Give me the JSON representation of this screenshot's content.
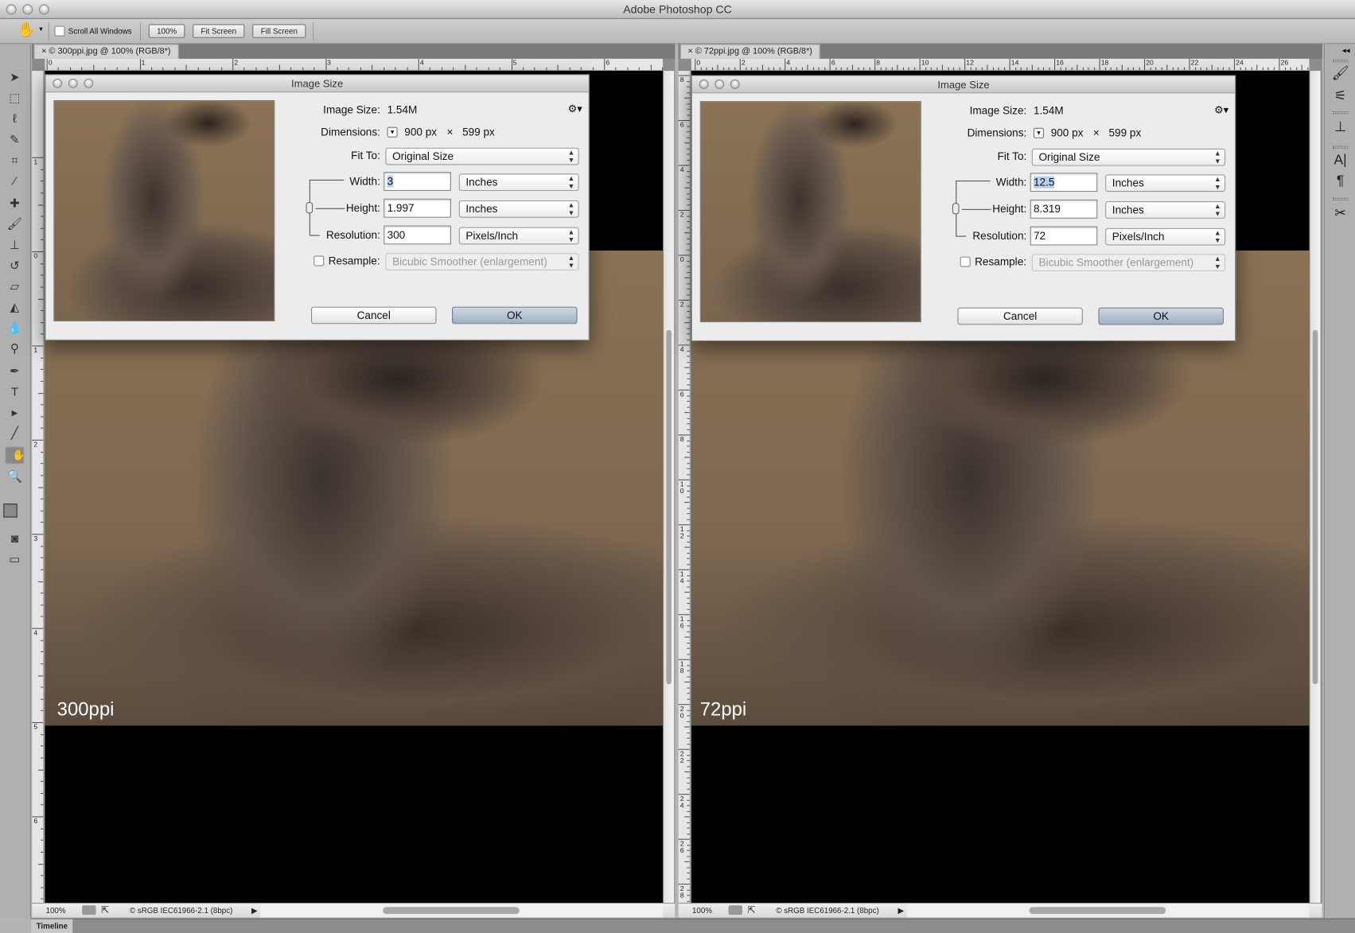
{
  "app": {
    "title": "Adobe Photoshop CC"
  },
  "options": {
    "scroll_all_windows": "Scroll All Windows",
    "zoom100": "100%",
    "fit_screen": "Fit Screen",
    "fill_screen": "Fill Screen"
  },
  "docs": [
    {
      "tab": "×  © 300ppi.jpg @ 100% (RGB/8*)",
      "overlay": "300ppi",
      "zoom": "100%",
      "profile": "© sRGB IEC61966-2.1 (8bpc)",
      "hruler": [
        "0",
        "1",
        "2",
        "3",
        "4",
        "5",
        "6"
      ],
      "vruler": [
        "1",
        "0",
        "1",
        "2",
        "3",
        "4",
        "5",
        "6"
      ]
    },
    {
      "tab": "×  © 72ppi.jpg @ 100% (RGB/8*)",
      "overlay": "72ppi",
      "zoom": "100%",
      "profile": "© sRGB IEC61966-2.1 (8bpc)",
      "hruler": [
        "0",
        "2",
        "4",
        "6",
        "8",
        "10",
        "12",
        "14",
        "16",
        "18",
        "20",
        "22",
        "24",
        "26"
      ],
      "vruler": [
        "8",
        "6",
        "4",
        "2",
        "0",
        "2",
        "4",
        "6",
        "8",
        "10",
        "12",
        "14",
        "16",
        "18",
        "20",
        "22",
        "24",
        "26",
        "28"
      ]
    }
  ],
  "dialogs": [
    {
      "title": "Image Size",
      "image_size_label": "Image Size:",
      "image_size": "1.54M",
      "dimensions_label": "Dimensions:",
      "dim_w": "900 px",
      "times": "×",
      "dim_h": "599 px",
      "fit_to_label": "Fit To:",
      "fit_to": "Original Size",
      "width_label": "Width:",
      "width": "3",
      "width_unit": "Inches",
      "height_label": "Height:",
      "height": "1.997",
      "height_unit": "Inches",
      "resolution_label": "Resolution:",
      "resolution": "300",
      "resolution_unit": "Pixels/Inch",
      "resample_label": "Resample:",
      "resample": "Bicubic Smoother (enlargement)",
      "cancel": "Cancel",
      "ok": "OK"
    },
    {
      "title": "Image Size",
      "image_size_label": "Image Size:",
      "image_size": "1.54M",
      "dimensions_label": "Dimensions:",
      "dim_w": "900 px",
      "times": "×",
      "dim_h": "599 px",
      "fit_to_label": "Fit To:",
      "fit_to": "Original Size",
      "width_label": "Width:",
      "width": "12.5",
      "width_unit": "Inches",
      "height_label": "Height:",
      "height": "8.319",
      "height_unit": "Inches",
      "resolution_label": "Resolution:",
      "resolution": "72",
      "resolution_unit": "Pixels/Inch",
      "resample_label": "Resample:",
      "resample": "Bicubic Smoother (enlargement)",
      "cancel": "Cancel",
      "ok": "OK"
    }
  ],
  "timeline": {
    "label": "Timeline"
  }
}
